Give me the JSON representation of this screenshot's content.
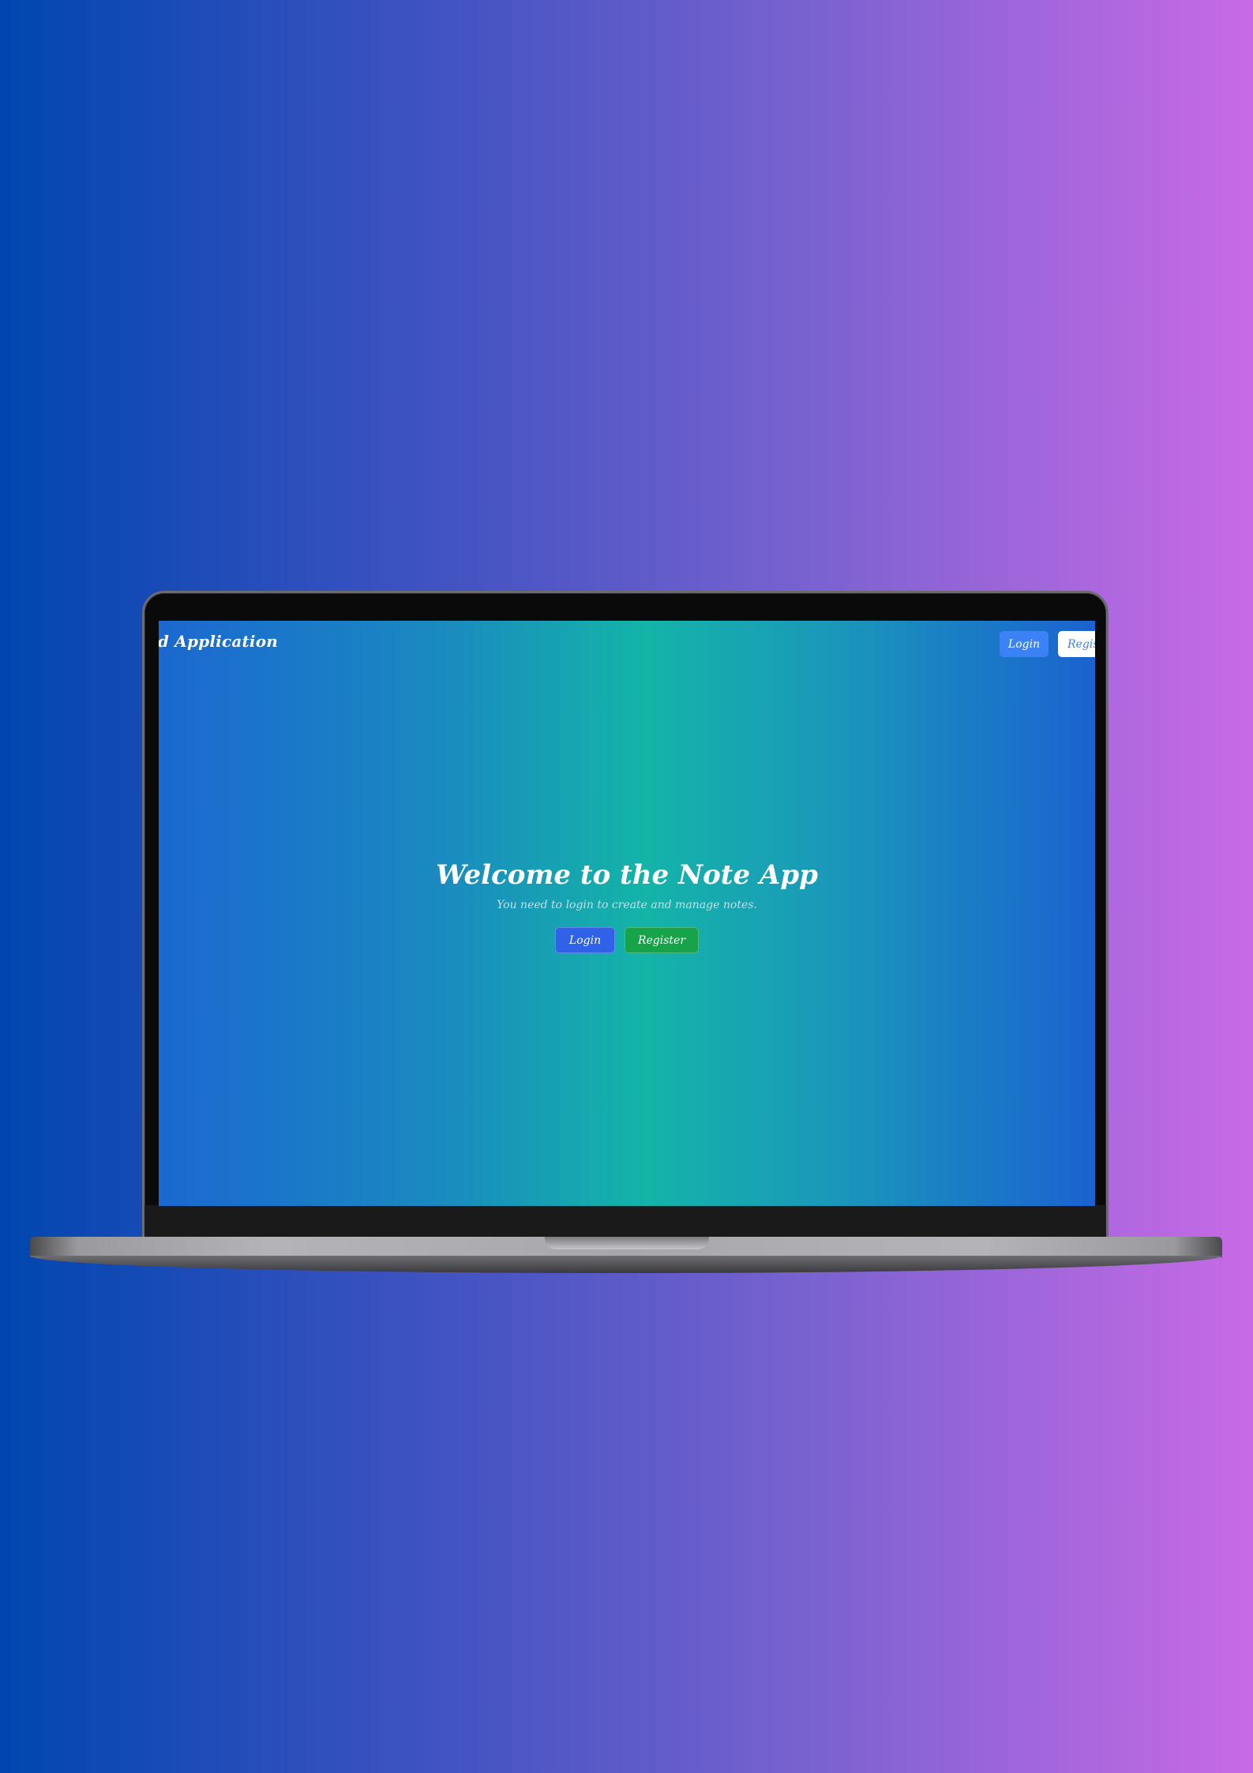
{
  "app": {
    "brand": "ed Application"
  },
  "nav": {
    "login_label": "Login",
    "register_label": "Regis"
  },
  "hero": {
    "title": "Welcome to the Note App",
    "subtitle": "You need to login to create and manage notes.",
    "login_label": "Login",
    "register_label": "Register"
  },
  "colors": {
    "background_start": "#0046b0",
    "background_end": "#c86ae6",
    "screen_center": "#14b4a8",
    "screen_edge": "#1b68d0",
    "login_button": "#2f62e8",
    "register_button": "#16a34a",
    "nav_login": "#3b82f6",
    "nav_register": "#ffffff"
  }
}
